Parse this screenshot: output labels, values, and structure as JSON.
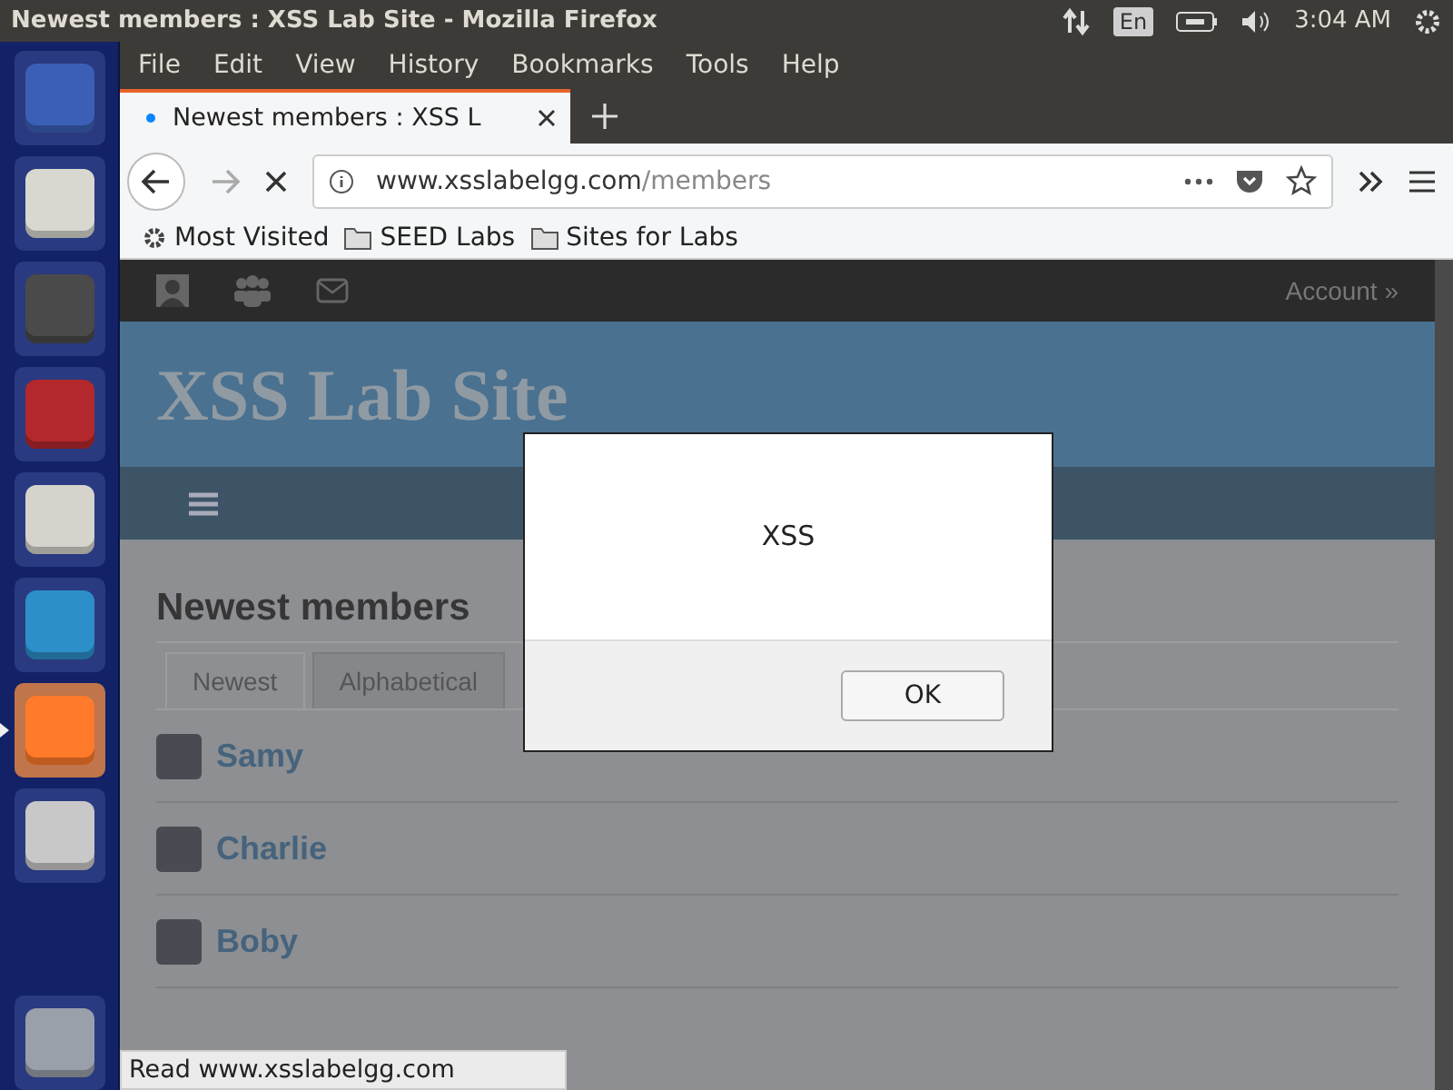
{
  "top_bar": {
    "title": "Newest members : XSS Lab Site - Mozilla Firefox",
    "keyboard": "En",
    "time": "3:04 AM"
  },
  "launcher": [
    {
      "kind": "ubuntu",
      "selected": false
    },
    {
      "kind": "editor",
      "selected": false
    },
    {
      "kind": "sublime",
      "selected": false
    },
    {
      "kind": "terminal",
      "selected": false
    },
    {
      "kind": "files",
      "selected": false
    },
    {
      "kind": "wireshark",
      "selected": false
    },
    {
      "kind": "firefox",
      "selected": true
    },
    {
      "kind": "settings",
      "selected": false
    },
    {
      "kind": "trash",
      "selected": false
    }
  ],
  "menu": [
    "File",
    "Edit",
    "View",
    "History",
    "Bookmarks",
    "Tools",
    "Help"
  ],
  "tabs": [
    {
      "label": "Newest members : XSS L",
      "selected": true
    }
  ],
  "address": {
    "host": "www.xsslabelgg.com",
    "path": "/members"
  },
  "bookmarks": [
    {
      "kind": "gear",
      "label": "Most Visited"
    },
    {
      "kind": "folder",
      "label": "SEED Labs"
    },
    {
      "kind": "folder",
      "label": "Sites for Labs"
    }
  ],
  "site": {
    "account": "Account »",
    "title": "XSS Lab Site",
    "heading": "Newest members",
    "tabs": [
      {
        "label": "Newest",
        "selected": true
      },
      {
        "label": "Alphabetical",
        "selected": false
      }
    ],
    "members": [
      {
        "name": "Samy"
      },
      {
        "name": "Charlie"
      },
      {
        "name": "Boby"
      }
    ]
  },
  "dialog": {
    "message": "XSS",
    "button": "OK"
  },
  "status": "Read www.xsslabelgg.com"
}
